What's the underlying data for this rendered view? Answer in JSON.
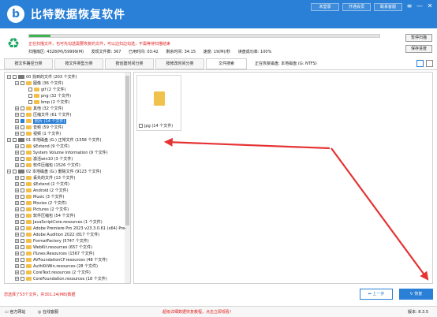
{
  "app": {
    "title": "比特数据恢复软件",
    "logo_letter": "b"
  },
  "titlebar": {
    "buttons": [
      "未登录",
      "开通会员",
      "联系客服"
    ],
    "controls": [
      "≡",
      "—",
      "✕"
    ]
  },
  "scan": {
    "progress_fraction": 0.06,
    "warning": "正在扫描文件，也可先勾选需要恢复的文件，可以边扫边勾选，不需等待扫描结束",
    "stats": [
      "扫描扇区: 4328(M)/59999(M)",
      "发现文件数: 367",
      "已用时间: 03:42",
      "剩余时间: 34:15",
      "速度: 19(M)/秒",
      "读盘成功率: 100%"
    ],
    "pause_label": "暂停扫描",
    "save_progress_label": "保存进度"
  },
  "tabs": [
    "按文件路径分类",
    "按文件类型分类",
    "按创建时间分类",
    "按修改时间分类",
    "文件搜索"
  ],
  "location": "正在恢复磁盘: 本地磁盘 (G: NTFS)",
  "tree": [
    {
      "indent": 0,
      "toggle": "-",
      "checked": false,
      "icon": "drive",
      "label": "00 找到的文件 (203 个文件)"
    },
    {
      "indent": 1,
      "toggle": "-",
      "checked": false,
      "icon": "folder",
      "label": "图像 (36 个文件)"
    },
    {
      "indent": 2,
      "toggle": "",
      "checked": false,
      "icon": "folder",
      "label": "gif (2 个文件)"
    },
    {
      "indent": 2,
      "toggle": "",
      "checked": false,
      "icon": "folder",
      "label": "png (32 个文件)"
    },
    {
      "indent": 2,
      "toggle": "",
      "checked": false,
      "icon": "folder",
      "label": "bmp (2 个文件)"
    },
    {
      "indent": 1,
      "toggle": "+",
      "checked": false,
      "icon": "folder",
      "label": "其他 (32 个文件)"
    },
    {
      "indent": 1,
      "toggle": "+",
      "checked": false,
      "icon": "folder",
      "label": "压缩文件 (61 个文件)"
    },
    {
      "indent": 1,
      "toggle": "+",
      "checked": true,
      "icon": "folder",
      "label": "照片 (14 个文件)",
      "selected": true
    },
    {
      "indent": 1,
      "toggle": "+",
      "checked": false,
      "icon": "folder",
      "label": "音频 (59 个文件)"
    },
    {
      "indent": 1,
      "toggle": "+",
      "checked": false,
      "icon": "folder",
      "label": "视频 (1 个文件)"
    },
    {
      "indent": 0,
      "toggle": "-",
      "checked": false,
      "icon": "drive",
      "label": "01 本地磁盘 (G:) 正常文件 (1558 个文件)"
    },
    {
      "indent": 1,
      "toggle": "+",
      "checked": false,
      "icon": "folder",
      "label": "$Extend (9 个文件)"
    },
    {
      "indent": 1,
      "toggle": "+",
      "checked": false,
      "icon": "folder",
      "label": "System Volume Information (9 个文件)"
    },
    {
      "indent": 1,
      "toggle": "+",
      "checked": false,
      "icon": "folder",
      "label": "激活win10 (3 个文件)"
    },
    {
      "indent": 1,
      "toggle": "+",
      "checked": false,
      "icon": "folder",
      "label": "软件压缩包 (1526 个文件)"
    },
    {
      "indent": 0,
      "toggle": "-",
      "checked": false,
      "icon": "drive",
      "label": "02 本地磁盘 (G:) 删除文件 (9123 个文件)"
    },
    {
      "indent": 1,
      "toggle": "+",
      "checked": false,
      "icon": "folder",
      "label": "丢失的文件 (13 个文件)"
    },
    {
      "indent": 1,
      "toggle": "+",
      "checked": false,
      "icon": "folder",
      "label": "$Extend (2 个文件)"
    },
    {
      "indent": 1,
      "toggle": "+",
      "checked": false,
      "icon": "folder",
      "label": "Android (2 个文件)"
    },
    {
      "indent": 1,
      "toggle": "+",
      "checked": false,
      "icon": "folder",
      "label": "Music (3 个文件)"
    },
    {
      "indent": 1,
      "toggle": "+",
      "checked": false,
      "icon": "folder",
      "label": "Movies (2 个文件)"
    },
    {
      "indent": 1,
      "toggle": "+",
      "checked": false,
      "icon": "folder",
      "label": "Pictures (2 个文件)"
    },
    {
      "indent": 1,
      "toggle": "+",
      "checked": false,
      "icon": "folder",
      "label": "软件压缩包 (54 个文件)"
    },
    {
      "indent": 1,
      "toggle": "+",
      "checked": false,
      "icon": "folder",
      "label": "JavaScriptCore.resources (1 个文件)"
    },
    {
      "indent": 1,
      "toggle": "+",
      "checked": false,
      "icon": "folder",
      "label": "Adobe Premiere Pro 2023 v23.3.0.61 (x64) Pre-"
    },
    {
      "indent": 1,
      "toggle": "+",
      "checked": false,
      "icon": "folder",
      "label": "Adobe Audition 2022 (817 个文件)"
    },
    {
      "indent": 1,
      "toggle": "+",
      "checked": false,
      "icon": "folder",
      "label": "FormatFactory (5747 个文件)"
    },
    {
      "indent": 1,
      "toggle": "+",
      "checked": false,
      "icon": "folder",
      "label": "WebKit.resources (657 个文件)"
    },
    {
      "indent": 1,
      "toggle": "+",
      "checked": false,
      "icon": "folder",
      "label": "iTunes.Resources (1567 个文件)"
    },
    {
      "indent": 1,
      "toggle": "+",
      "checked": false,
      "icon": "folder",
      "label": "AVFoundationCF.resources (48 个文件)"
    },
    {
      "indent": 1,
      "toggle": "+",
      "checked": false,
      "icon": "folder",
      "label": "AuthKitWin.resources (28 个文件)"
    },
    {
      "indent": 1,
      "toggle": "+",
      "checked": false,
      "icon": "folder",
      "label": "CoreText.resources (2 个文件)"
    },
    {
      "indent": 1,
      "toggle": "+",
      "checked": false,
      "icon": "folder",
      "label": "CoreFoundation.resources (18 个文件)"
    }
  ],
  "preview": {
    "file_label": "jpg (14 个文件)"
  },
  "bottom": {
    "status": "您选择了53个文件，共301.24(MB)数据",
    "prev_label": "上一步",
    "recover_label": "恢复"
  },
  "footer": {
    "website": "官方网站",
    "consult": "在线客服",
    "link": "超级详细数据恢复教程，点击立即观看！",
    "version": "版本: 8.3.5"
  }
}
